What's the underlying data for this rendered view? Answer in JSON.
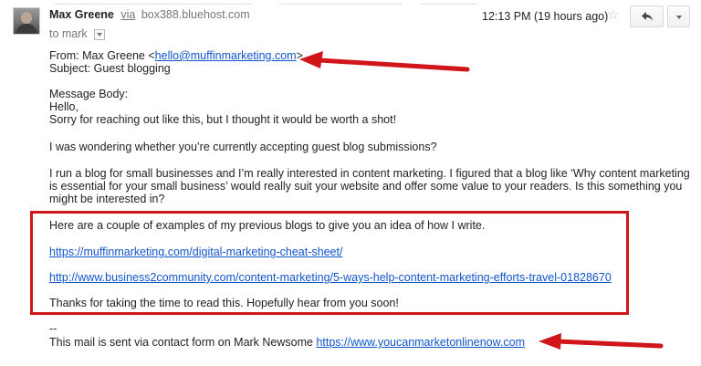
{
  "email": {
    "sender_name": "Max Greene",
    "via_label": "via",
    "via_host": "box388.bluehost.com",
    "to_label": "to mark",
    "timestamp": "12:13 PM (19 hours ago)"
  },
  "body": {
    "from_prefix": "From: Max Greene <",
    "from_email": "hello@muffinmarketing.com",
    "from_suffix": ">",
    "subject": "Subject: Guest blogging",
    "message_label": "Message Body:",
    "greeting": "Hello,",
    "intro": "Sorry for reaching out like this, but I thought it would be worth a shot!",
    "question": "I was wondering whether you’re currently accepting guest blog submissions?",
    "para1_line1": "I run a blog for small businesses and I’m really interested in content marketing. I figured that a blog like ‘Why content marketing",
    "para1_line2": "is essential for your small business’ would really suit your website and offer some value to your readers. Is this something you",
    "para1_line3": "might be interested in?",
    "examples_intro": "Here are a couple of examples of my previous blogs to give you an idea of how I write.",
    "link1": "https://muffinmarketing.com/digital-marketing-cheat-sheet/",
    "link2": "http://www.business2community.com/content-marketing/5-ways-help-content-marketing-efforts-travel-01828670",
    "thanks": "Thanks for taking the time to read this. Hopefully hear from you soon!",
    "sig_dashes": "--",
    "footer_prefix": "This mail is sent via contact form on Mark Newsome ",
    "footer_link": "https://www.youcanmarketonlinenow.com"
  },
  "icons": {
    "star": "star-icon",
    "reply": "reply-icon",
    "more": "chevron-down-icon"
  },
  "colors": {
    "link": "#1155cc",
    "annotation_red": "#d0151b"
  }
}
